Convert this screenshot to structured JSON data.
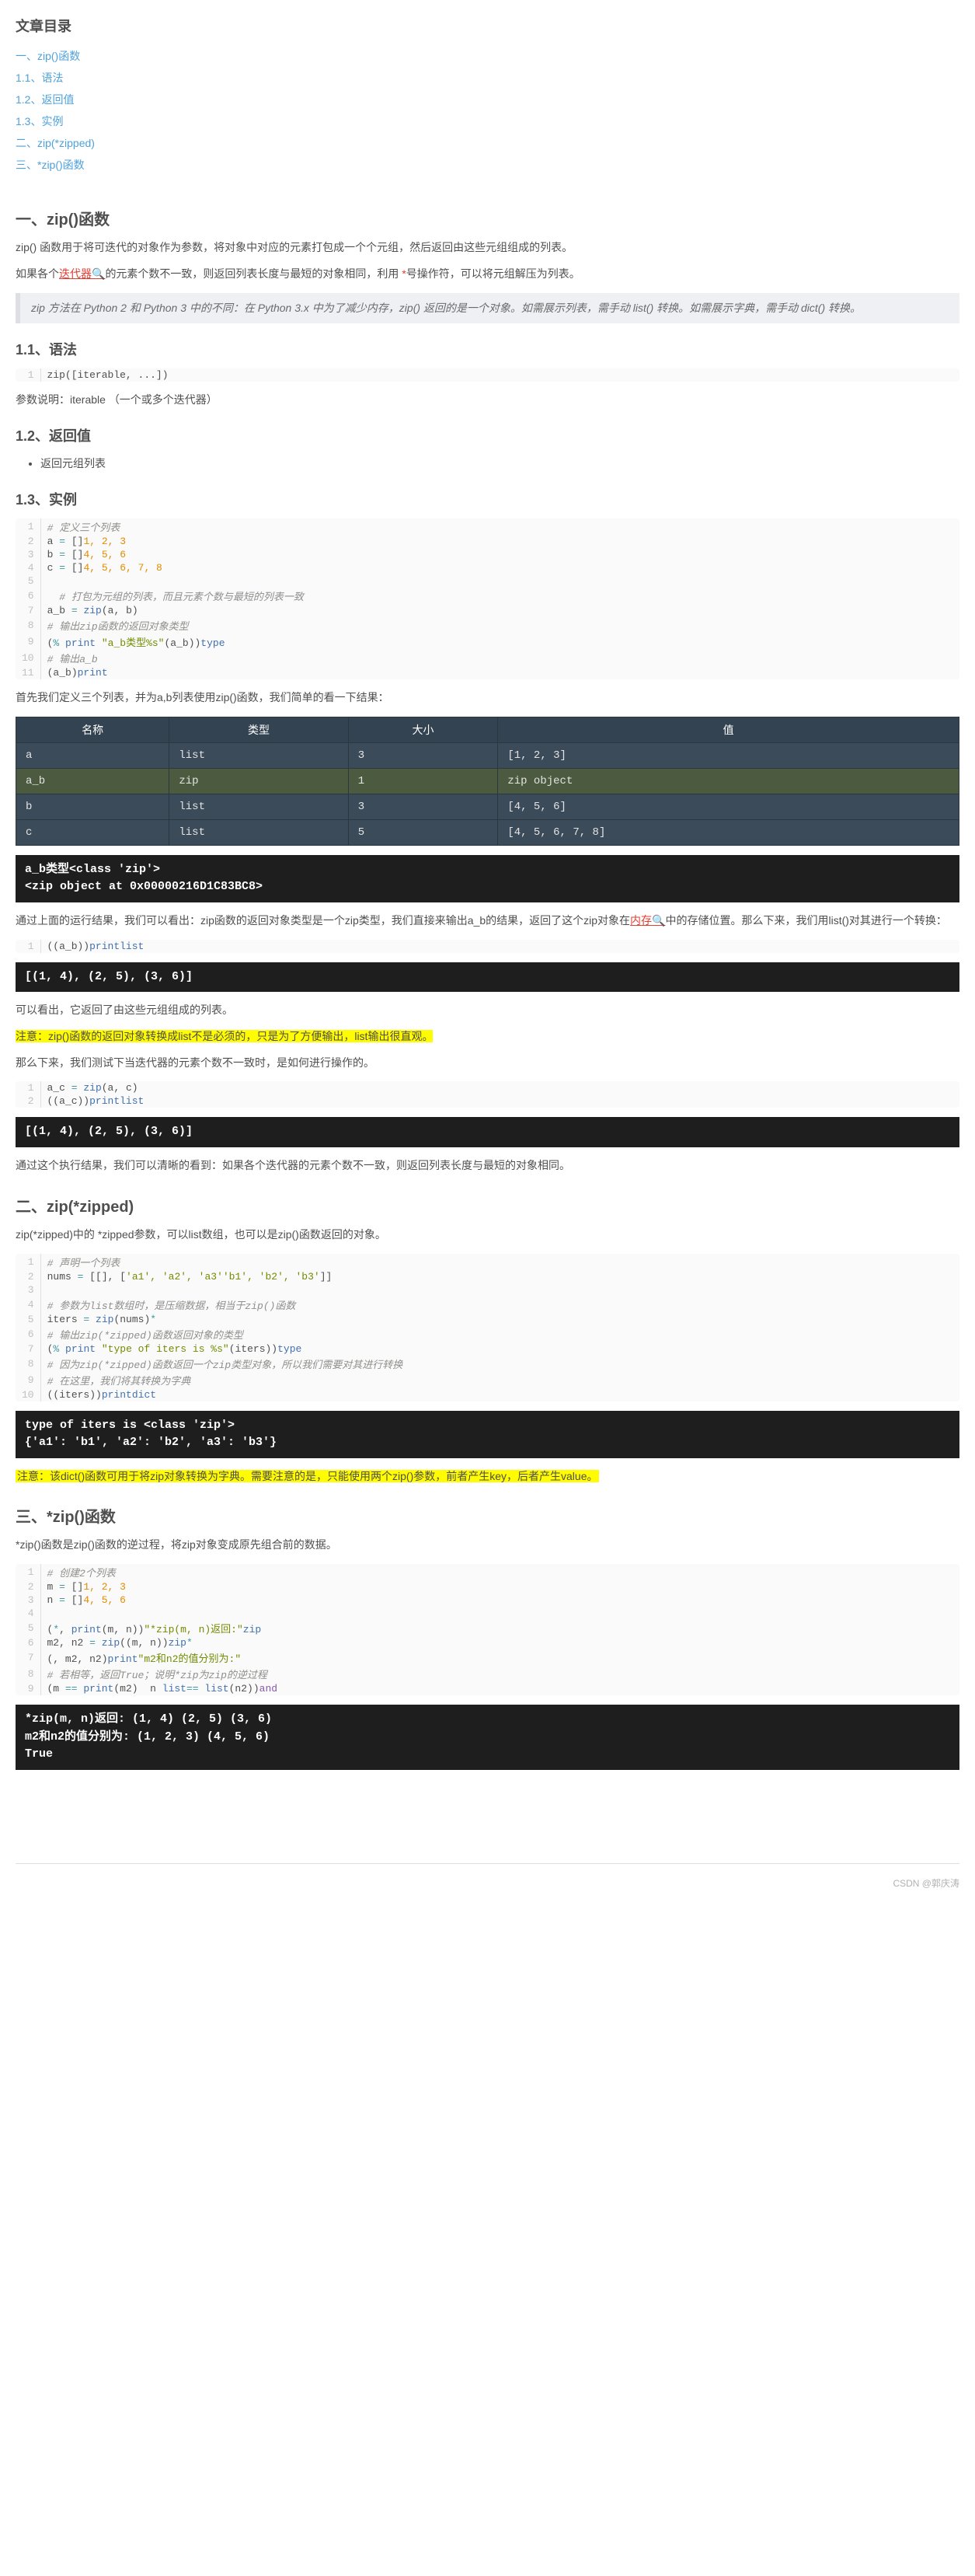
{
  "toc": {
    "title": "文章目录",
    "items": [
      {
        "level": 1,
        "label": "一、zip()函数"
      },
      {
        "level": 2,
        "label": "1.1、语法"
      },
      {
        "level": 2,
        "label": "1.2、返回值"
      },
      {
        "level": 2,
        "label": "1.3、实例"
      },
      {
        "level": 1,
        "label": "二、zip(*zipped)"
      },
      {
        "level": 1,
        "label": "三、*zip()函数"
      }
    ]
  },
  "s1": {
    "h": "一、zip()函数",
    "p1": "zip() 函数用于将可迭代的对象作为参数，将对象中对应的元素打包成一个个元组，然后返回由这些元组组成的列表。",
    "p2a": "如果各个",
    "p2link": "迭代器",
    "p2b": "的元素个数不一致，则返回列表长度与最短的对象相同，利用 ",
    "p2c": "号操作符，可以将元组解压为列表。",
    "bq": "zip 方法在 Python 2 和 Python 3 中的不同：在 Python 3.x 中为了减少内存，zip() 返回的是一个对象。如需展示列表，需手动 list() 转换。如需展示字典，需手动 dict() 转换。"
  },
  "s11": {
    "h": "1.1、语法",
    "code": [
      {
        "t": "zip([iterable, ...])"
      }
    ],
    "p": "参数说明：iterable （一个或多个迭代器）"
  },
  "s12": {
    "h": "1.2、返回值",
    "li": "返回元组列表"
  },
  "s13": {
    "h": "1.3、实例",
    "code1": [
      {
        "cm": "# 定义三个列表"
      },
      {
        "t": "a ",
        "op": "=",
        "t2": " [",
        "nm": "1, 2, 3",
        "t3": "]"
      },
      {
        "t": "b ",
        "op": "=",
        "t2": " [",
        "nm": "4, 5, 6",
        "t3": "]"
      },
      {
        "t": "c ",
        "op": "=",
        "t2": " [",
        "nm": "4, 5, 6, 7, 8",
        "t3": "]"
      },
      {
        "t": " "
      },
      {
        "cm": "  # 打包为元组的列表，而且元素个数与最短的列表一致"
      },
      {
        "t": "a_b ",
        "op": "=",
        "t2": " ",
        "fn": "zip",
        "t3": "(a, b)"
      },
      {
        "cm": "# 输出zip函数的返回对象类型"
      },
      {
        "fn": "print",
        "t": "(",
        "st": "\"a_b类型%s\"",
        "t2": " ",
        "op": "%",
        "t3": " ",
        "fn2": "type",
        "t4": "(a_b))"
      },
      {
        "cm": "# 输出a_b"
      },
      {
        "fn": "print",
        "t": "(a_b)"
      }
    ],
    "p1": "首先我们定义三个列表，并为a,b列表使用zip()函数，我们简单的看一下结果：",
    "vth": {
      "name": "名称",
      "type": "类型",
      "size": "大小",
      "val": "值"
    },
    "vt": [
      {
        "name": "a",
        "type": "list",
        "size": "3",
        "val": "[1, 2, 3]",
        "hl": false
      },
      {
        "name": "a_b",
        "type": "zip",
        "size": "1",
        "val": "zip object",
        "hl": true
      },
      {
        "name": "b",
        "type": "list",
        "size": "3",
        "val": "[4, 5, 6]",
        "hl": false
      },
      {
        "name": "c",
        "type": "list",
        "size": "5",
        "val": "[4, 5, 6, 7, 8]",
        "hl": false
      }
    ],
    "db1": "a_b类型<class 'zip'>\n<zip object at 0x00000216D1C83BC8>",
    "p2a": "通过上面的运行结果，我们可以看出：zip函数的返回对象类型是一个zip类型，我们直接来输出a_b的结果，返回了这个zip对象在",
    "p2link": "内存",
    "p2b": "中的存储位置。那么下来，我们用list()对其进行一个转换：",
    "code2": [
      {
        "fn": "print",
        "t": "(",
        "fn2": "list",
        "t2": "(a_b))"
      }
    ],
    "db2": "[(1, 4), (2, 5), (3, 6)]",
    "p3": "可以看出，它返回了由这些元组组成的列表。",
    "p4": "注意：zip()函数的返回对象转换成list不是必须的，只是为了方便输出，list输出很直观。",
    "p5": "那么下来，我们测试下当迭代器的元素个数不一致时，是如何进行操作的。",
    "code3": [
      {
        "t": "a_c ",
        "op": "=",
        "t2": " ",
        "fn": "zip",
        "t3": "(a, c)"
      },
      {
        "fn": "print",
        "t": "(",
        "fn2": "list",
        "t2": "(a_c))"
      }
    ],
    "db3": "[(1, 4), (2, 5), (3, 6)]",
    "p6": "通过这个执行结果，我们可以清晰的看到：如果各个迭代器的元素个数不一致，则返回列表长度与最短的对象相同。"
  },
  "s2": {
    "h": "二、zip(*zipped)",
    "p1": "zip(*zipped)中的 *zipped参数，可以list数组，也可以是zip()函数返回的对象。",
    "code": [
      {
        "cm": "# 声明一个列表"
      },
      {
        "t": "nums ",
        "op": "=",
        "t2": " [[",
        "st": "'a1', 'a2', 'a3'",
        "t3": "], [",
        "st2": "'b1', 'b2', 'b3'",
        "t4": "]]"
      },
      {
        "t": " "
      },
      {
        "cm": "# 参数为list数组时，是压缩数据，相当于zip()函数"
      },
      {
        "t": "iters ",
        "op": "=",
        "t2": " ",
        "fn": "zip",
        "t3": "(",
        "op2": "*",
        "t4": "nums)"
      },
      {
        "cm": "# 输出zip(*zipped)函数返回对象的类型"
      },
      {
        "fn": "print",
        "t": "(",
        "st": "\"type of iters is %s\"",
        "t2": " ",
        "op": "%",
        "t3": " ",
        "fn2": "type",
        "t4": "(iters))"
      },
      {
        "cm": "# 因为zip(*zipped)函数返回一个zip类型对象，所以我们需要对其进行转换"
      },
      {
        "cm": "# 在这里，我们将其转换为字典"
      },
      {
        "fn": "print",
        "t": "(",
        "fn2": "dict",
        "t2": "(iters))"
      }
    ],
    "db": "type of iters is <class 'zip'>\n{'a1': 'b1', 'a2': 'b2', 'a3': 'b3'}",
    "p2": "注意：该dict()函数可用于将zip对象转换为字典。需要注意的是，只能使用两个zip()参数，前者产生key，后者产生value。"
  },
  "s3": {
    "h": "三、*zip()函数",
    "p1": "*zip()函数是zip()函数的逆过程，将zip对象变成原先组合前的数据。",
    "code": [
      {
        "cm": "# 创建2个列表"
      },
      {
        "t": "m ",
        "op": "=",
        "t2": " [",
        "nm": "1, 2, 3",
        "t3": "]"
      },
      {
        "t": "n ",
        "op": "=",
        "t2": " [",
        "nm": "4, 5, 6",
        "t3": "]"
      },
      {
        "t": " "
      },
      {
        "fn": "print",
        "t": "(",
        "st": "\"*zip(m, n)返回:\"",
        "t2": ", ",
        "op": "*",
        "fn2": "zip",
        "t3": "(m, n))"
      },
      {
        "t": "m2, n2 ",
        "op": "=",
        "t2": " ",
        "fn": "zip",
        "t3": "(",
        "op2": "*",
        "fn2": "zip",
        "t4": "(m, n))"
      },
      {
        "fn": "print",
        "t": "(",
        "st": "\"m2和n2的值分别为:\"",
        "t2": ", m2, n2)"
      },
      {
        "cm": "# 若相等，返回True；说明*zip为zip的逆过程"
      },
      {
        "fn": "print",
        "t": "(m ",
        "op": "==",
        "t2": " ",
        "fn2": "list",
        "t3": "(m2) ",
        "kw": "and",
        "t4": " n ",
        "op2": "==",
        "t5": " ",
        "fn3": "list",
        "t6": "(n2))"
      }
    ],
    "db": "*zip(m, n)返回: (1, 4) (2, 5) (3, 6)\nm2和n2的值分别为: (1, 2, 3) (4, 5, 6)\nTrue"
  },
  "footer": "CSDN @郭庆涛"
}
